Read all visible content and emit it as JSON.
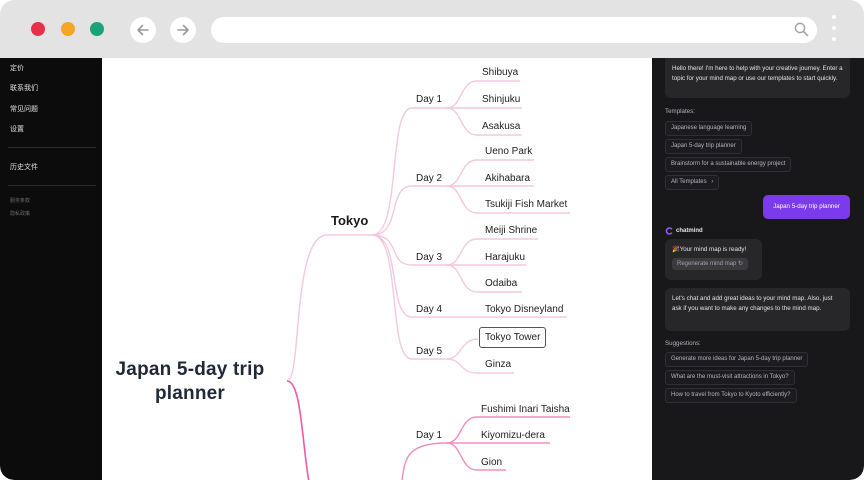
{
  "browser": {
    "url": "",
    "traffic_lights": [
      "#e8304a",
      "#f5a623",
      "#1aa37a"
    ]
  },
  "sidebar": {
    "items": [
      "定价",
      "联系我们",
      "常见问题",
      "设置"
    ],
    "history_label": "历史文件",
    "footer_links": [
      "服务条款",
      "隐私政策"
    ]
  },
  "mindmap": {
    "root": "Japan 5-day trip planner",
    "cities": [
      {
        "name": "Tokyo",
        "days": [
          {
            "label": "Day 1",
            "items": [
              "Shibuya",
              "Shinjuku",
              "Asakusa"
            ]
          },
          {
            "label": "Day 2",
            "items": [
              "Ueno Park",
              "Akihabara",
              "Tsukiji Fish Market"
            ]
          },
          {
            "label": "Day 3",
            "items": [
              "Meiji Shrine",
              "Harajuku",
              "Odaiba"
            ]
          },
          {
            "label": "Day 4",
            "items": [
              "Tokyo Disneyland"
            ]
          },
          {
            "label": "Day 5",
            "items": [
              "Tokyo Tower",
              "Ginza"
            ]
          }
        ]
      },
      {
        "name": "",
        "days": [
          {
            "label": "Day 1",
            "items": [
              "Fushimi Inari Taisha",
              "Kiyomizu-dera",
              "Gion"
            ]
          }
        ]
      }
    ],
    "selected": "Tokyo Tower",
    "colors": {
      "tokyo_branch": "#f3c9dd",
      "root_branch": "#ec5aa6",
      "kyoto_branch": "#ef8fbf"
    }
  },
  "chat": {
    "welcome": "Hello there! I'm here to help with your creative journey. Enter a topic for your mind map or use our templates to start quickly.",
    "templates_label": "Templates:",
    "templates": [
      "Japanese language learning",
      "Japan 5-day trip planner",
      "Brainstorm for a sustainable energy project"
    ],
    "all_templates": "All Templates",
    "user_message": "Japan 5-day trip planner",
    "brand": "chatmind",
    "ready": "🎉Your mind map is ready!",
    "regenerate": "Regenerate mind map",
    "followup": "Let's chat and add great ideas to your mind map. Also, just ask if you want to make any changes to the mind map.",
    "suggestions_label": "Suggestions:",
    "suggestions": [
      "Generate more ideas for Japan 5-day trip planner",
      "What are the must-visit attractions in Tokyo?",
      "How to travel from Tokyo to Kyoto efficiently?"
    ],
    "accent": "#7c3aed"
  }
}
